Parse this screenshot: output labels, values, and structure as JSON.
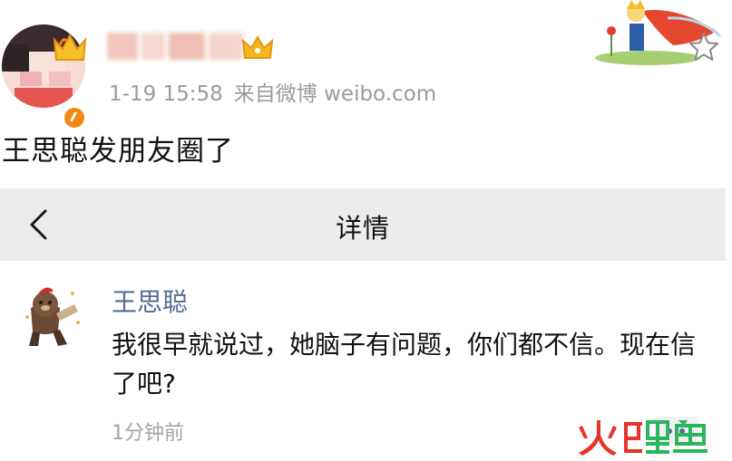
{
  "post": {
    "timestamp": "1-19 15:58",
    "source": "来自微博 weibo.com",
    "text": "王思聪发朋友圈了"
  },
  "wechat_detail": {
    "title": "详情",
    "comment": {
      "author": "王思聪",
      "text": "我很早就说过，她脑子有问题，你们都不信。现在信了吧?",
      "time": "1分钟前"
    }
  },
  "watermark": {
    "text": "火鲤鱼"
  },
  "icons": {
    "back": "chevron-left-icon",
    "favorite": "star-outline-icon",
    "member": "crown-icon",
    "verified": "verified-badge-icon",
    "more": "more-dots-icon"
  },
  "colors": {
    "meta_gray": "#9b9b9b",
    "wechat_name_blue": "#566b94",
    "nav_bar_gray": "#ececec",
    "verified_orange": "#f08a15",
    "crown_gold": "#f2b720",
    "watermark_red": "#e8332b",
    "watermark_green": "#2bb55c"
  }
}
